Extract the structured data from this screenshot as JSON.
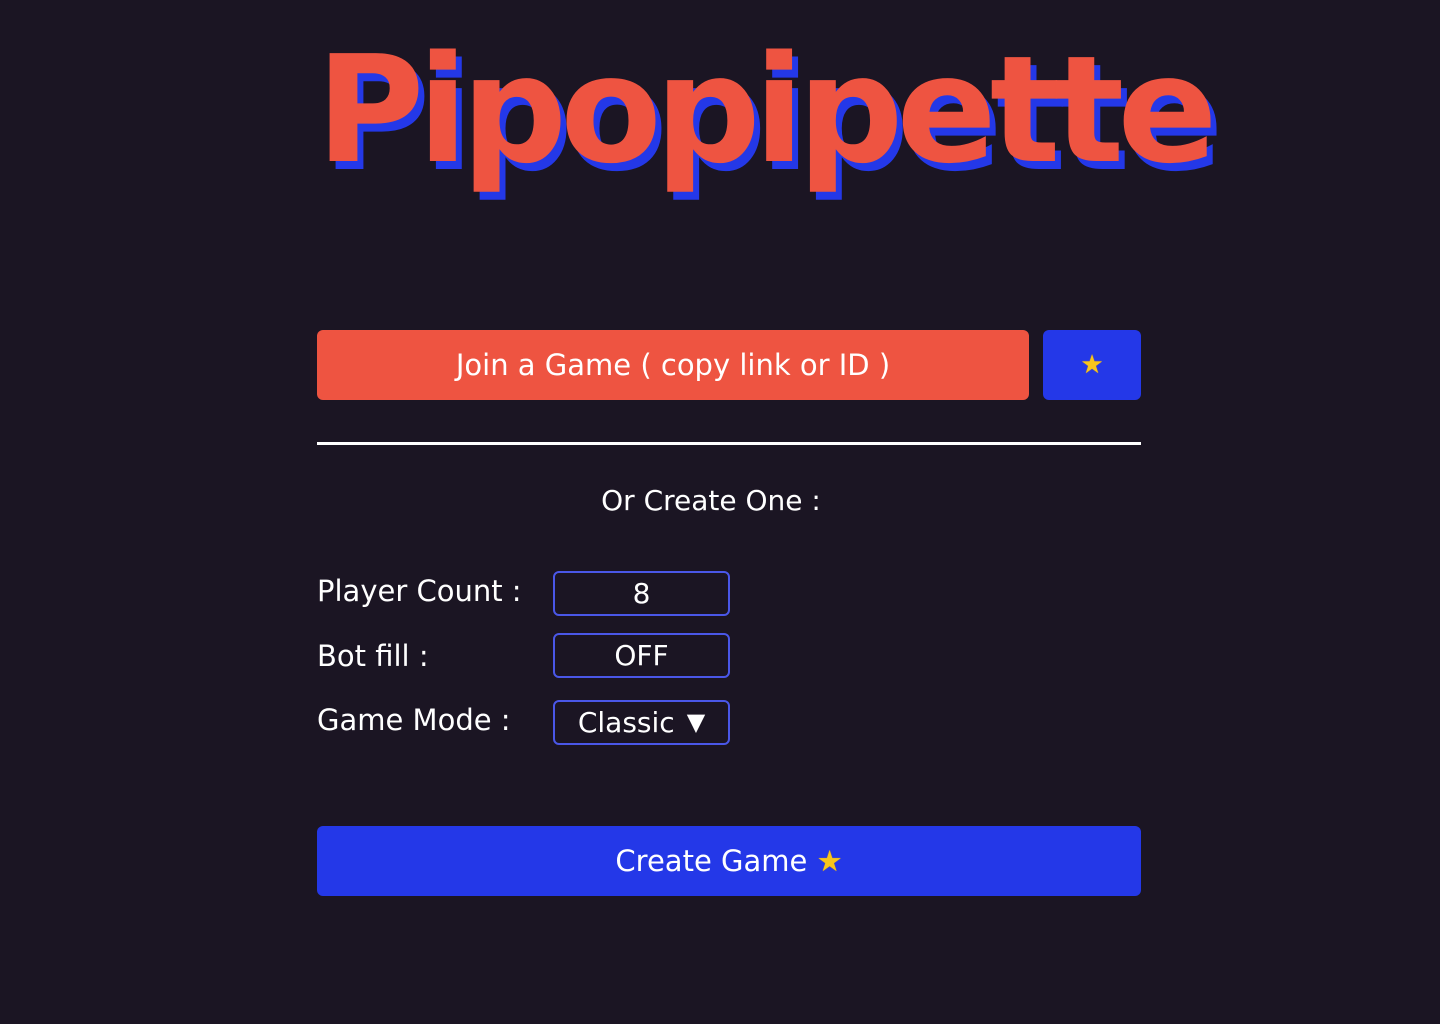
{
  "app": {
    "title": "Pipopipette"
  },
  "join": {
    "label": "Join a Game ( copy link or ID )",
    "star_icon": "star-icon",
    "star_glyph": "★"
  },
  "create": {
    "heading": "Or Create One :",
    "player_count": {
      "label": "Player Count :",
      "value": "8"
    },
    "bot_fill": {
      "label": "Bot fill :",
      "value": "OFF"
    },
    "game_mode": {
      "label": "Game Mode :",
      "selected": "Classic",
      "chevron": "▼"
    },
    "button_label": "Create Game",
    "button_icon": "star-icon",
    "button_glyph": "★"
  },
  "colors": {
    "background": "#1b1523",
    "accent_red": "#ee5441",
    "accent_blue": "#2438e8",
    "input_border": "#4a57e8",
    "star": "#f8c51c"
  }
}
